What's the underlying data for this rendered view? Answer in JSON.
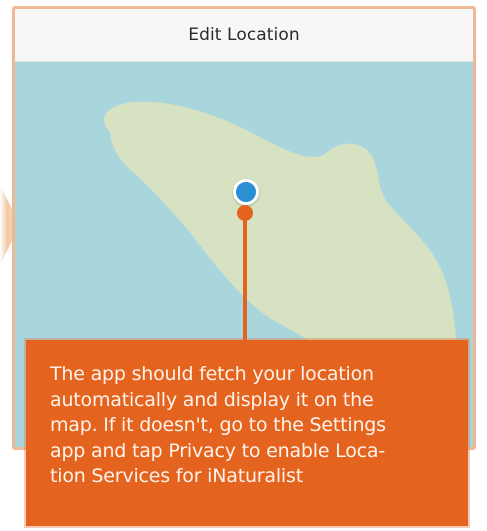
{
  "header": {
    "title": "Edit Location"
  },
  "callout": {
    "lines": [
      "The app should fetch your location",
      "automatically and display it on the",
      "map. If it doesn't,  go to the Settings",
      "app and tap Privacy to enable Loca-",
      "tion Services for iNaturalist"
    ]
  },
  "colors": {
    "accent": "#e4641f",
    "water": "#a9d6dd",
    "land": "#d6e2c2",
    "marker": "#2b8fd6"
  }
}
